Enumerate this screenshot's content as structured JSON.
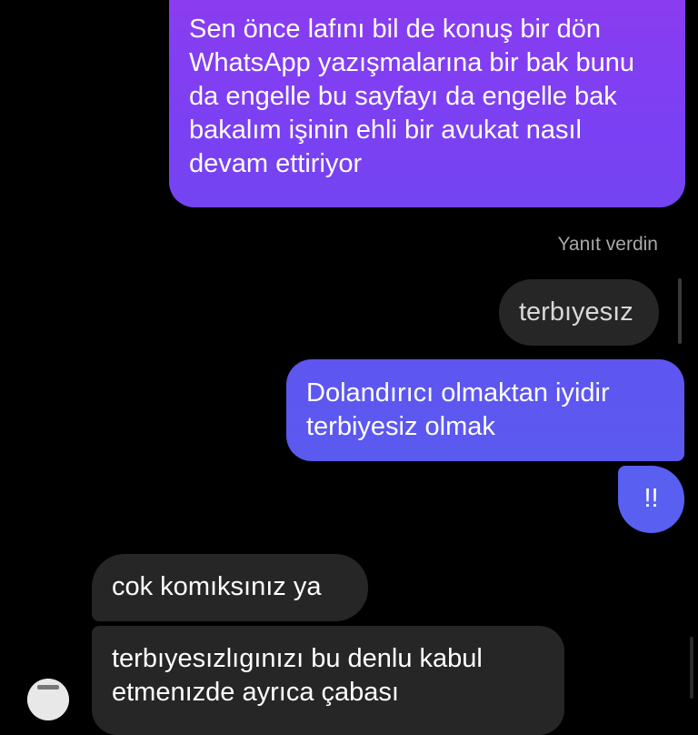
{
  "messages": {
    "outgoing_1": "Sen önce lafını bil de konuş bir dön WhatsApp yazışmalarına bir bak bunu da engelle bu sayfayı da engelle bak bakalım işinin ehli bir avukat nasıl devam ettiriyor",
    "reply_label": "Yanıt verdin",
    "quoted_reply": "terbıyesız",
    "outgoing_2": "Dolandırıcı olmaktan iyidir terbiyesiz olmak",
    "outgoing_3": "!!",
    "incoming_1": "cok komıksınız ya",
    "incoming_2": "terbıyesızlıgınızı bu denlu kabul etmenızde ayrıca çabası"
  },
  "colors": {
    "background": "#000000",
    "sent_gradient_top": "#8a3cf0",
    "sent_gradient_bottom": "#5a5aef",
    "received_bubble": "#262626",
    "meta_text": "#a8a8a8"
  },
  "icons": {
    "avatar": "profile-avatar"
  }
}
